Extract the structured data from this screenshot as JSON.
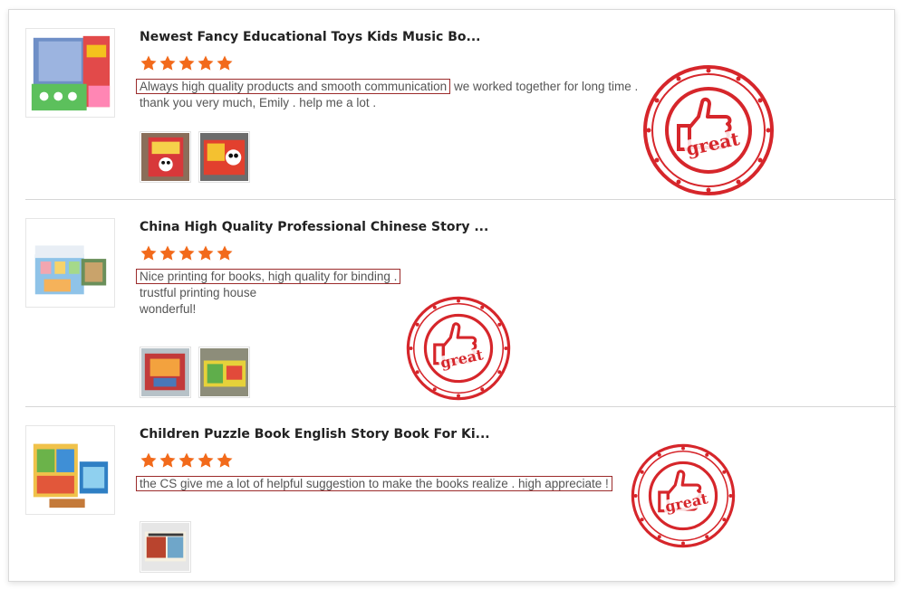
{
  "reviews": [
    {
      "title": "Newest Fancy Educational Toys Kids Music Bo...",
      "rating": 5,
      "comment_highlight": "Always high quality products and smooth communication",
      "comment_rest": " we worked together for long time .",
      "comment_lines": [
        "thank you very much, Emily . help me a lot ."
      ],
      "photo_count": 2
    },
    {
      "title": "China High Quality Professional Chinese Story ...",
      "rating": 5,
      "comment_highlight": "Nice printing for books, high quality for binding .",
      "comment_rest": "",
      "comment_lines": [
        "trustful printing house",
        "wonderful!"
      ],
      "photo_count": 2
    },
    {
      "title": "Children Puzzle Book English Story Book For Ki...",
      "rating": 5,
      "comment_highlight": "the CS give me a lot of helpful suggestion to make the books realize . high appreciate !",
      "comment_rest": "",
      "comment_lines": [],
      "photo_count": 1
    }
  ],
  "stamp": {
    "text": "great",
    "icon": "thumbs-up-icon",
    "color": "#d6262b"
  },
  "colors": {
    "star": "#f26a1b",
    "highlight_border": "#9b2b2b",
    "divider": "#d6d6d6"
  }
}
